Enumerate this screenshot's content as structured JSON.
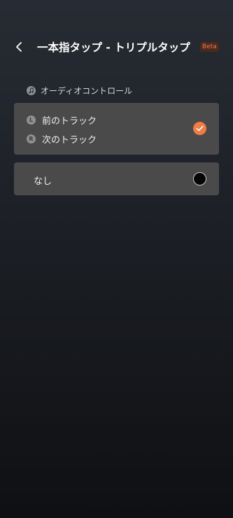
{
  "header": {
    "back_icon": "chevron-left-icon",
    "title": "一本指タップ - トリプルタップ",
    "badge": "Beta"
  },
  "section": {
    "icon": "music-note-icon",
    "label": "オーディオコントロール"
  },
  "options": [
    {
      "rows": [
        {
          "side": "L",
          "label": "前のトラック"
        },
        {
          "side": "R",
          "label": "次のトラック"
        }
      ],
      "selected": true,
      "indicator_icon": "check-icon"
    },
    {
      "label": "なし",
      "selected": false,
      "indicator_icon": "radio-icon"
    }
  ],
  "colors": {
    "accent": "#ef7d45",
    "card_bg": "#4a4a4b",
    "badge_text": "#ef7b4a"
  }
}
